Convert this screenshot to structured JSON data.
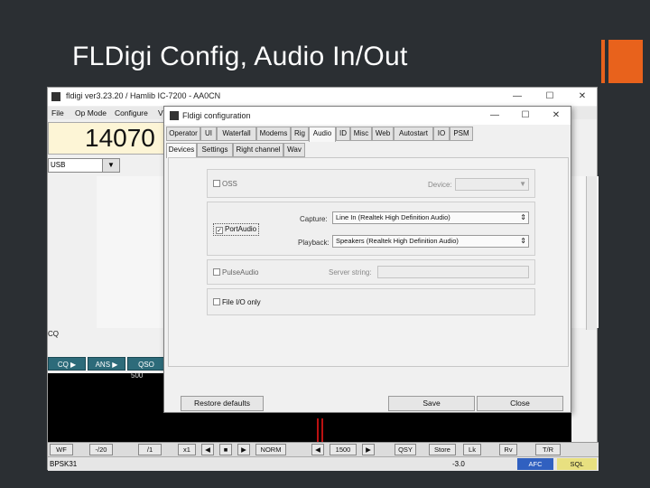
{
  "slide": {
    "title": "FLDigi Config, Audio In/Out",
    "accent_color": "#e8621c"
  },
  "main_window": {
    "title": "fldigi ver3.23.20 / Hamlib IC-7200 - AA0CN",
    "controls": [
      "—",
      "☐",
      "✕"
    ],
    "menu": [
      "File",
      "Op Mode",
      "Configure",
      "V"
    ],
    "frequency": "14070",
    "mode_combo": "USB",
    "cq_label": "CQ",
    "macros": [
      "CQ ▶",
      "ANS ▶",
      "QSO"
    ],
    "waterfall_marker": "500",
    "bottom_buttons": [
      "WF",
      "-/20",
      "/1",
      "x1",
      "◀",
      "■",
      "▶",
      "NORM",
      "◀",
      "1500",
      "▶",
      "QSY",
      "Store",
      "Lk",
      "Rv",
      "T/R"
    ],
    "status_left": "BPSK31",
    "status_value": "-3.0",
    "afc_label": "AFC",
    "sql_label": "SQL"
  },
  "dialog": {
    "title": "Fldigi configuration",
    "controls": [
      "—",
      "☐",
      "✕"
    ],
    "tabs": [
      "Operator",
      "UI",
      "Waterfall",
      "Modems",
      "Rig",
      "Audio",
      "ID",
      "Misc",
      "Web",
      "Autostart",
      "IO",
      "PSM"
    ],
    "active_tab": "Audio",
    "subtabs": [
      "Devices",
      "Settings",
      "Right channel",
      "Wav"
    ],
    "active_subtab": "Devices",
    "oss": {
      "label": "OSS",
      "device_label": "Device:",
      "device_value": ""
    },
    "portaudio": {
      "label": "PortAudio",
      "checked": true,
      "capture_label": "Capture:",
      "capture_value": "Line In (Realtek High Definition Audio)",
      "playback_label": "Playback:",
      "playback_value": "Speakers (Realtek High Definition Audio)"
    },
    "pulseaudio": {
      "label": "PulseAudio",
      "server_label": "Server string:",
      "server_value": ""
    },
    "fileio": {
      "label": "File I/O only"
    },
    "buttons": {
      "restore": "Restore defaults",
      "save": "Save",
      "close": "Close"
    }
  }
}
